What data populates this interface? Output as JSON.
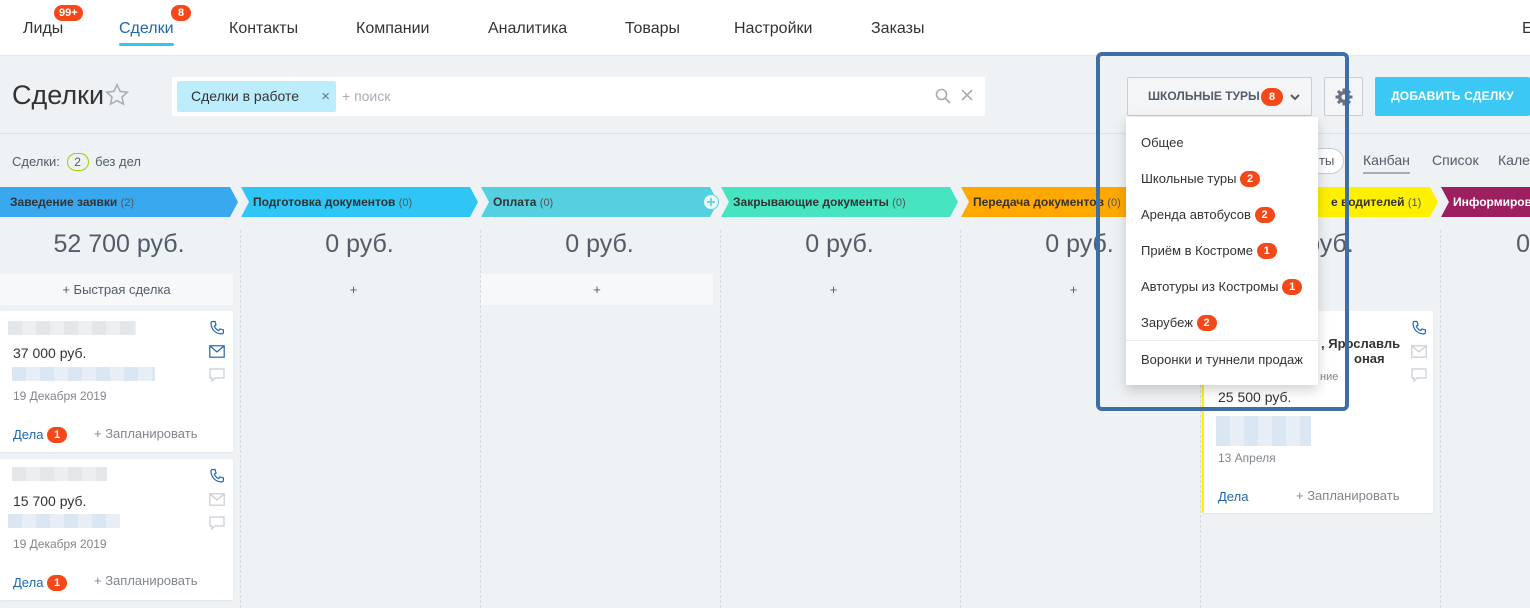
{
  "nav": {
    "items": [
      {
        "label": "Лиды",
        "badge": "99+"
      },
      {
        "label": "Сделки",
        "badge": "8"
      },
      {
        "label": "Контакты"
      },
      {
        "label": "Компании"
      },
      {
        "label": "Аналитика"
      },
      {
        "label": "Товары"
      },
      {
        "label": "Настройки"
      },
      {
        "label": "Заказы"
      },
      {
        "label": "Е"
      }
    ]
  },
  "header": {
    "title": "Сделки",
    "filter_chip": "Сделки в работе",
    "chip_close": "×",
    "search_placeholder": "+ поиск",
    "pipeline_button": "ШКОЛЬНЫЕ ТУРЫ",
    "pipeline_badge": "8",
    "add_button": "ДОБАВИТЬ СДЕЛКУ"
  },
  "subbar": {
    "count_label": "Сделки:",
    "count": "2",
    "count_suffix": "без дел",
    "filter_pill": "ты",
    "views": [
      "Канбан",
      "Список",
      "Кале"
    ]
  },
  "stages": [
    {
      "name": "Заведение заявки",
      "count": "(2)",
      "color": "#39a8ef",
      "sum": "52 700 руб."
    },
    {
      "name": "Подготовка документов",
      "count": "(0)",
      "color": "#2fc6f6",
      "sum": "0 руб."
    },
    {
      "name": "Оплата",
      "count": "(0)",
      "color": "#55d0e0",
      "sum": "0 руб."
    },
    {
      "name": "Закрывающие документы",
      "count": "(0)",
      "color": "#47e4c2",
      "sum": "0 руб."
    },
    {
      "name": "Передача документов",
      "count": "(0)",
      "color": "#ffa900",
      "sum": "0 руб."
    },
    {
      "name": "е водителей",
      "count": "(1)",
      "color": "#fff000",
      "sum": "0 руб."
    },
    {
      "name": "Информиров",
      "count": "",
      "color": "#9c1f5f",
      "sum": "0"
    }
  ],
  "quick_deal": "+ Быстрая сделка",
  "plus": "+",
  "cards": [
    {
      "price": "37 000 руб.",
      "date": "19 Декабря 2019",
      "dela": "Дела",
      "dela_badge": "1",
      "plan": "+ Запланировать"
    },
    {
      "price": "15 700 руб.",
      "date": "19 Декабря 2019",
      "dela": "Дела",
      "dela_badge": "1",
      "plan": "+ Запланировать"
    },
    {
      "title_line1": ", Ярославль",
      "title_line2": "оная",
      "subtitle": "ние",
      "price": "25 500 руб.",
      "date": "13 Апреля",
      "dela": "Дела",
      "plan": "+ Запланировать"
    }
  ],
  "dropdown": {
    "items": [
      {
        "label": "Общее",
        "badge": ""
      },
      {
        "label": "Школьные туры",
        "badge": "2"
      },
      {
        "label": "Аренда автобусов",
        "badge": "2"
      },
      {
        "label": "Приём в Костроме",
        "badge": "1"
      },
      {
        "label": "Автотуры из Костромы",
        "badge": "1"
      },
      {
        "label": "Зарубеж",
        "badge": "2"
      }
    ],
    "footer": "Воронки и туннели продаж"
  },
  "colors": {
    "accent": "#2fc6f6",
    "badge": "#f54819",
    "link": "#2067b0",
    "add_button": "#3bc8f5",
    "highlight": "#3d6fa5"
  }
}
